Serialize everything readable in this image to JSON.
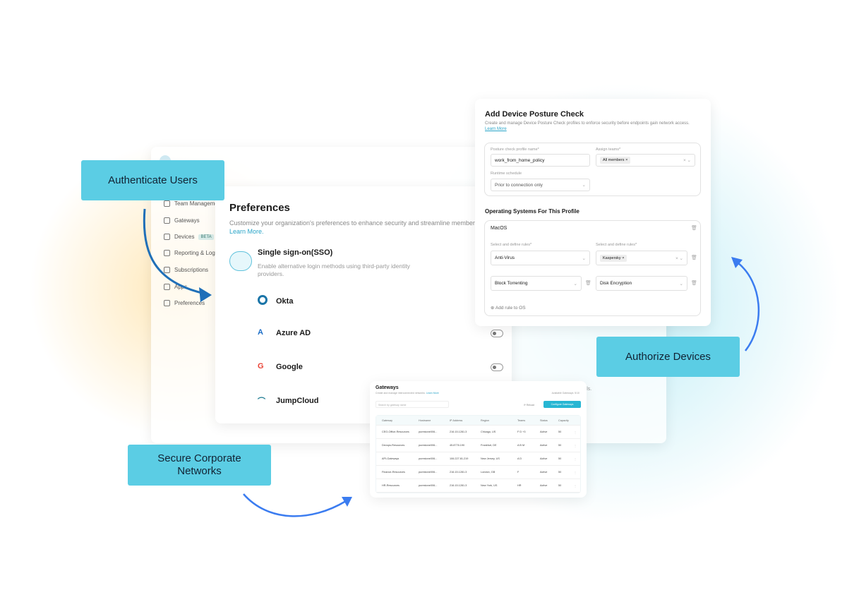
{
  "callouts": {
    "authenticate": "Authenticate Users",
    "authorize": "Authorize Devices",
    "secure": "Secure Corporate Networks"
  },
  "sidebar": {
    "items": [
      {
        "label": "Team Management",
        "icon": "users-icon"
      },
      {
        "label": "Gateways",
        "icon": "globe-icon"
      },
      {
        "label": "Devices",
        "icon": "devices-icon",
        "badge": "BETA"
      },
      {
        "label": "Reporting & Logs",
        "icon": "activity-icon"
      },
      {
        "label": "Subscriptions",
        "icon": "receipt-icon"
      },
      {
        "label": "Apps",
        "icon": "apps-icon"
      },
      {
        "label": "Preferences",
        "icon": "gear-icon"
      }
    ]
  },
  "preferences": {
    "title": "Preferences",
    "description": "Customize your organization's preferences to enhance security and streamline member ma",
    "learn_more": "Learn More.",
    "sso": {
      "title": "Single sign-on(SSO)",
      "description": "Enable alternative login methods using third-party identity providers."
    },
    "providers": [
      {
        "name": "Okta",
        "enabled": true
      },
      {
        "name": "Azure AD",
        "enabled": false
      },
      {
        "name": "Google",
        "enabled": false
      },
      {
        "name": "JumpCloud",
        "enabled": false
      }
    ]
  },
  "posture": {
    "title": "Add Device Posture Check",
    "description": "Create and manage Device Posture Check profiles to enforce security before endpoints gain network access.",
    "learn_more": "Learn More",
    "profile_label": "Posture check profile name*",
    "profile_value": "work_from_home_policy",
    "teams_label": "Assign teams*",
    "teams_chip": "All members",
    "schedule_label": "Runtime schedule",
    "schedule_value": "Prior to connection only",
    "os_section": "Operating Systems For This Profile",
    "os": "MacOS",
    "rules_label": "Select and define rules*",
    "rules": [
      "Anti-Virus",
      "Kaspersky",
      "Block Torrenting",
      "Disk Encryption"
    ],
    "add_rule": "Add rule to OS"
  },
  "back_text": "ore details.",
  "gateways": {
    "title": "Gateways",
    "subtitle": "Create and manage interconnected networks.",
    "learn_more": "Learn More",
    "available": "Available Gateways: 5/10",
    "search_placeholder": "Search by gateway name",
    "reload": "Reload",
    "configure": "Configure Gateways",
    "columns": [
      "Gateway",
      "Hostname",
      "IP Address",
      "Region",
      "Teams",
      "Status",
      "Capacity"
    ],
    "rows": [
      [
        "CEO-Office-Resources",
        "purestone006...",
        "216.15.1281.3",
        "Chicago, US",
        "F  D  +3",
        "Active",
        "50"
      ],
      [
        "Devops-Resources",
        "purestone006...",
        "45.8776.190",
        "Frankfurt, DE",
        "A  B  M",
        "Active",
        "50"
      ],
      [
        "API-Gateways",
        "purestone006...",
        "106.227.81.219",
        "New Jersey, US",
        "A  D",
        "Active",
        "50"
      ],
      [
        "Finance-Resources",
        "purestone006...",
        "216.15.1281.3",
        "London, GB",
        "F",
        "Active",
        "50"
      ],
      [
        "HR-Resources",
        "purestone006...",
        "216.15.1281.3",
        "New York, US",
        "HR",
        "Active",
        "50"
      ]
    ]
  },
  "colors": {
    "callout": "#5bcde4",
    "accent": "#27b6d3",
    "arrow_dark": "#1f6fb8",
    "arrow_light": "#3b7cf0"
  }
}
